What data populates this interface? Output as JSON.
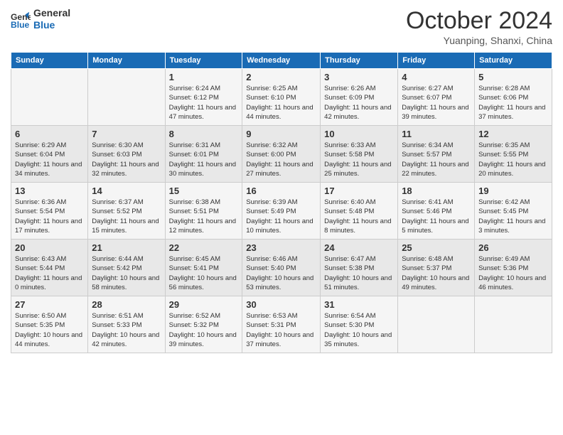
{
  "logo": {
    "line1": "General",
    "line2": "Blue"
  },
  "title": "October 2024",
  "subtitle": "Yuanping, Shanxi, China",
  "days_of_week": [
    "Sunday",
    "Monday",
    "Tuesday",
    "Wednesday",
    "Thursday",
    "Friday",
    "Saturday"
  ],
  "weeks": [
    [
      {
        "day": "",
        "sunrise": "",
        "sunset": "",
        "daylight": ""
      },
      {
        "day": "",
        "sunrise": "",
        "sunset": "",
        "daylight": ""
      },
      {
        "day": "1",
        "sunrise": "Sunrise: 6:24 AM",
        "sunset": "Sunset: 6:12 PM",
        "daylight": "Daylight: 11 hours and 47 minutes."
      },
      {
        "day": "2",
        "sunrise": "Sunrise: 6:25 AM",
        "sunset": "Sunset: 6:10 PM",
        "daylight": "Daylight: 11 hours and 44 minutes."
      },
      {
        "day": "3",
        "sunrise": "Sunrise: 6:26 AM",
        "sunset": "Sunset: 6:09 PM",
        "daylight": "Daylight: 11 hours and 42 minutes."
      },
      {
        "day": "4",
        "sunrise": "Sunrise: 6:27 AM",
        "sunset": "Sunset: 6:07 PM",
        "daylight": "Daylight: 11 hours and 39 minutes."
      },
      {
        "day": "5",
        "sunrise": "Sunrise: 6:28 AM",
        "sunset": "Sunset: 6:06 PM",
        "daylight": "Daylight: 11 hours and 37 minutes."
      }
    ],
    [
      {
        "day": "6",
        "sunrise": "Sunrise: 6:29 AM",
        "sunset": "Sunset: 6:04 PM",
        "daylight": "Daylight: 11 hours and 34 minutes."
      },
      {
        "day": "7",
        "sunrise": "Sunrise: 6:30 AM",
        "sunset": "Sunset: 6:03 PM",
        "daylight": "Daylight: 11 hours and 32 minutes."
      },
      {
        "day": "8",
        "sunrise": "Sunrise: 6:31 AM",
        "sunset": "Sunset: 6:01 PM",
        "daylight": "Daylight: 11 hours and 30 minutes."
      },
      {
        "day": "9",
        "sunrise": "Sunrise: 6:32 AM",
        "sunset": "Sunset: 6:00 PM",
        "daylight": "Daylight: 11 hours and 27 minutes."
      },
      {
        "day": "10",
        "sunrise": "Sunrise: 6:33 AM",
        "sunset": "Sunset: 5:58 PM",
        "daylight": "Daylight: 11 hours and 25 minutes."
      },
      {
        "day": "11",
        "sunrise": "Sunrise: 6:34 AM",
        "sunset": "Sunset: 5:57 PM",
        "daylight": "Daylight: 11 hours and 22 minutes."
      },
      {
        "day": "12",
        "sunrise": "Sunrise: 6:35 AM",
        "sunset": "Sunset: 5:55 PM",
        "daylight": "Daylight: 11 hours and 20 minutes."
      }
    ],
    [
      {
        "day": "13",
        "sunrise": "Sunrise: 6:36 AM",
        "sunset": "Sunset: 5:54 PM",
        "daylight": "Daylight: 11 hours and 17 minutes."
      },
      {
        "day": "14",
        "sunrise": "Sunrise: 6:37 AM",
        "sunset": "Sunset: 5:52 PM",
        "daylight": "Daylight: 11 hours and 15 minutes."
      },
      {
        "day": "15",
        "sunrise": "Sunrise: 6:38 AM",
        "sunset": "Sunset: 5:51 PM",
        "daylight": "Daylight: 11 hours and 12 minutes."
      },
      {
        "day": "16",
        "sunrise": "Sunrise: 6:39 AM",
        "sunset": "Sunset: 5:49 PM",
        "daylight": "Daylight: 11 hours and 10 minutes."
      },
      {
        "day": "17",
        "sunrise": "Sunrise: 6:40 AM",
        "sunset": "Sunset: 5:48 PM",
        "daylight": "Daylight: 11 hours and 8 minutes."
      },
      {
        "day": "18",
        "sunrise": "Sunrise: 6:41 AM",
        "sunset": "Sunset: 5:46 PM",
        "daylight": "Daylight: 11 hours and 5 minutes."
      },
      {
        "day": "19",
        "sunrise": "Sunrise: 6:42 AM",
        "sunset": "Sunset: 5:45 PM",
        "daylight": "Daylight: 11 hours and 3 minutes."
      }
    ],
    [
      {
        "day": "20",
        "sunrise": "Sunrise: 6:43 AM",
        "sunset": "Sunset: 5:44 PM",
        "daylight": "Daylight: 11 hours and 0 minutes."
      },
      {
        "day": "21",
        "sunrise": "Sunrise: 6:44 AM",
        "sunset": "Sunset: 5:42 PM",
        "daylight": "Daylight: 10 hours and 58 minutes."
      },
      {
        "day": "22",
        "sunrise": "Sunrise: 6:45 AM",
        "sunset": "Sunset: 5:41 PM",
        "daylight": "Daylight: 10 hours and 56 minutes."
      },
      {
        "day": "23",
        "sunrise": "Sunrise: 6:46 AM",
        "sunset": "Sunset: 5:40 PM",
        "daylight": "Daylight: 10 hours and 53 minutes."
      },
      {
        "day": "24",
        "sunrise": "Sunrise: 6:47 AM",
        "sunset": "Sunset: 5:38 PM",
        "daylight": "Daylight: 10 hours and 51 minutes."
      },
      {
        "day": "25",
        "sunrise": "Sunrise: 6:48 AM",
        "sunset": "Sunset: 5:37 PM",
        "daylight": "Daylight: 10 hours and 49 minutes."
      },
      {
        "day": "26",
        "sunrise": "Sunrise: 6:49 AM",
        "sunset": "Sunset: 5:36 PM",
        "daylight": "Daylight: 10 hours and 46 minutes."
      }
    ],
    [
      {
        "day": "27",
        "sunrise": "Sunrise: 6:50 AM",
        "sunset": "Sunset: 5:35 PM",
        "daylight": "Daylight: 10 hours and 44 minutes."
      },
      {
        "day": "28",
        "sunrise": "Sunrise: 6:51 AM",
        "sunset": "Sunset: 5:33 PM",
        "daylight": "Daylight: 10 hours and 42 minutes."
      },
      {
        "day": "29",
        "sunrise": "Sunrise: 6:52 AM",
        "sunset": "Sunset: 5:32 PM",
        "daylight": "Daylight: 10 hours and 39 minutes."
      },
      {
        "day": "30",
        "sunrise": "Sunrise: 6:53 AM",
        "sunset": "Sunset: 5:31 PM",
        "daylight": "Daylight: 10 hours and 37 minutes."
      },
      {
        "day": "31",
        "sunrise": "Sunrise: 6:54 AM",
        "sunset": "Sunset: 5:30 PM",
        "daylight": "Daylight: 10 hours and 35 minutes."
      },
      {
        "day": "",
        "sunrise": "",
        "sunset": "",
        "daylight": ""
      },
      {
        "day": "",
        "sunrise": "",
        "sunset": "",
        "daylight": ""
      }
    ]
  ]
}
